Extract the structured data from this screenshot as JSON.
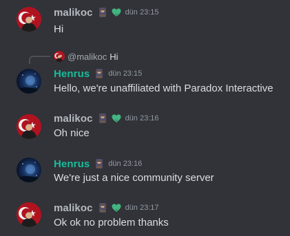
{
  "colors": {
    "background": "#313338",
    "malikoc_name": "#b5bac1",
    "henrus_name": "#1abc9c",
    "text": "#dbdee1",
    "timestamp": "#949ba4"
  },
  "messages": [
    {
      "author": "malikoc",
      "avatar": "turkish-flag-avatar",
      "timestamp": "dün 23:15",
      "content": "Hi",
      "badges": [
        "person-role-icon",
        "green-heart-icon"
      ]
    },
    {
      "author": "Henrus",
      "avatar": "blue-night-avatar",
      "timestamp": "dün 23:15",
      "content": "Hello, we're unaffiliated with Paradox Interactive",
      "badges": [
        "person-role-icon"
      ],
      "reply": {
        "author": "@malikoc",
        "content": "Hi"
      }
    },
    {
      "author": "malikoc",
      "avatar": "turkish-flag-avatar",
      "timestamp": "dün 23:16",
      "content": "Oh nice",
      "badges": [
        "person-role-icon",
        "green-heart-icon"
      ]
    },
    {
      "author": "Henrus",
      "avatar": "blue-night-avatar",
      "timestamp": "dün 23:16",
      "content": "We're just a nice community server",
      "badges": [
        "person-role-icon"
      ]
    },
    {
      "author": "malikoc",
      "avatar": "turkish-flag-avatar",
      "timestamp": "dün 23:17",
      "content": "Ok ok no problem thanks",
      "badges": [
        "person-role-icon",
        "green-heart-icon"
      ]
    }
  ]
}
